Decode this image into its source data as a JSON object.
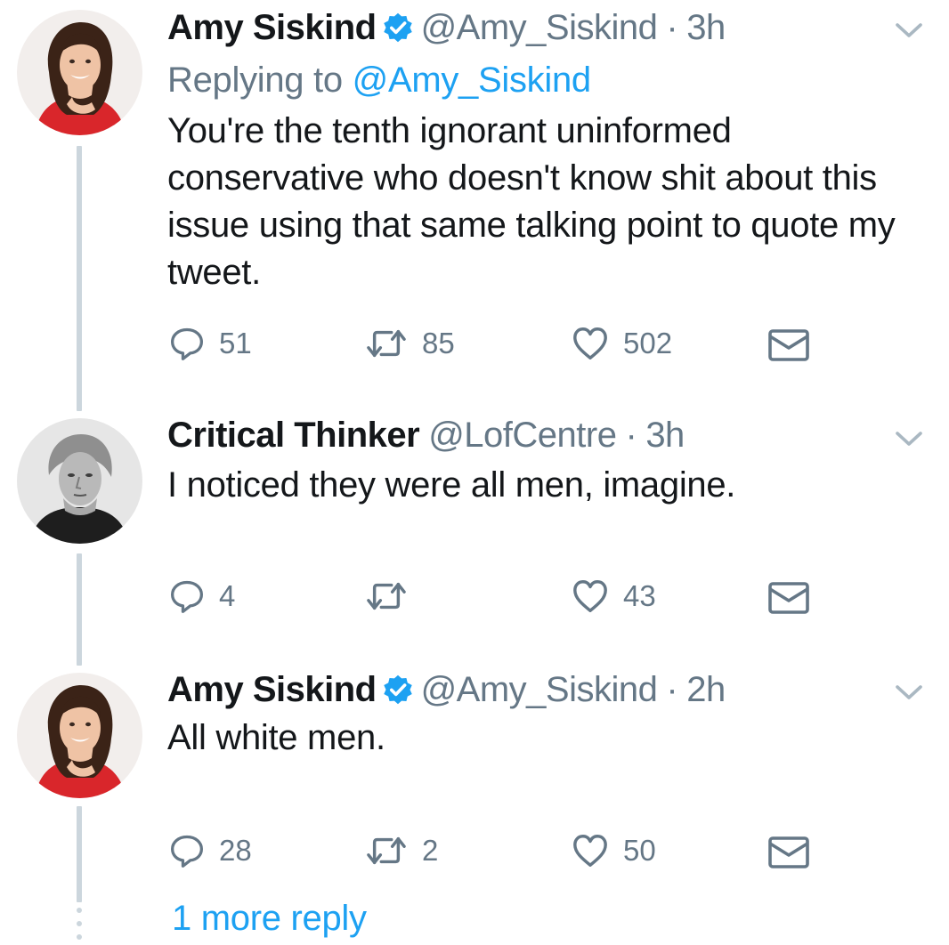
{
  "tweets": [
    {
      "name": "Amy Siskind",
      "verified": true,
      "handle": "@Amy_Siskind",
      "separator": "·",
      "time": "3h",
      "replying_prefix": "Replying to",
      "replying_to": "@Amy_Siskind",
      "text": "You're the tenth ignorant uninformed conservative who doesn't know shit about this issue using that same talking point to quote my tweet.",
      "replies": "51",
      "retweets": "85",
      "likes": "502"
    },
    {
      "name": "Critical Thinker",
      "verified": false,
      "handle": "@LofCentre",
      "separator": "·",
      "time": "3h",
      "text": "I noticed they were all men, imagine.",
      "replies": "4",
      "retweets": "",
      "likes": "43"
    },
    {
      "name": "Amy Siskind",
      "verified": true,
      "handle": "@Amy_Siskind",
      "separator": "·",
      "time": "2h",
      "text": "All white men.",
      "replies": "28",
      "retweets": "2",
      "likes": "50"
    }
  ],
  "more_replies_label": "1 more reply",
  "colors": {
    "accent": "#1da1f2",
    "secondary_text": "#657786",
    "thread_line": "#ccd6dd",
    "avatar_red": "#d9262b"
  },
  "icons": [
    "reply-icon",
    "retweet-icon",
    "like-icon",
    "direct-message-icon",
    "chevron-down-icon",
    "verified-badge-icon"
  ]
}
